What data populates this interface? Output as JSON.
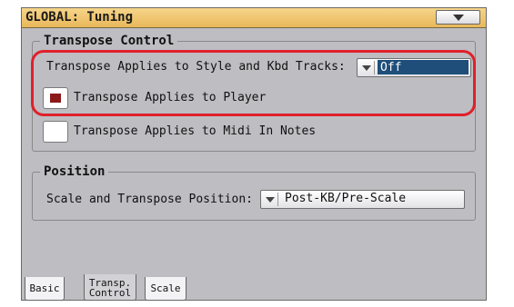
{
  "window": {
    "title": "GLOBAL: Tuning"
  },
  "transpose_group": {
    "legend": "Transpose Control",
    "style_kbd_label": "Transpose Applies to Style and Kbd Tracks:",
    "style_kbd_value": "Off",
    "player_label": "Transpose Applies to Player",
    "player_checked": true,
    "midi_label": "Transpose Applies to Midi In Notes",
    "midi_checked": false
  },
  "position_group": {
    "legend": "Position",
    "scale_transpose_label": "Scale and Transpose Position:",
    "scale_transpose_value": "Post-KB/Pre-Scale"
  },
  "tabs": [
    {
      "label": "Basic"
    },
    {
      "label_line1": "Transp.",
      "label_line2": "Control"
    },
    {
      "label": "Scale"
    }
  ],
  "active_tab": "Transp. Control",
  "colors": {
    "title_bar": "#e9b85a",
    "selected_value_bg": "#1f4e7a",
    "checkbox_mark": "#8b1a1a",
    "highlight": "#e0202a",
    "panel_bg": "#bdbdc2"
  }
}
